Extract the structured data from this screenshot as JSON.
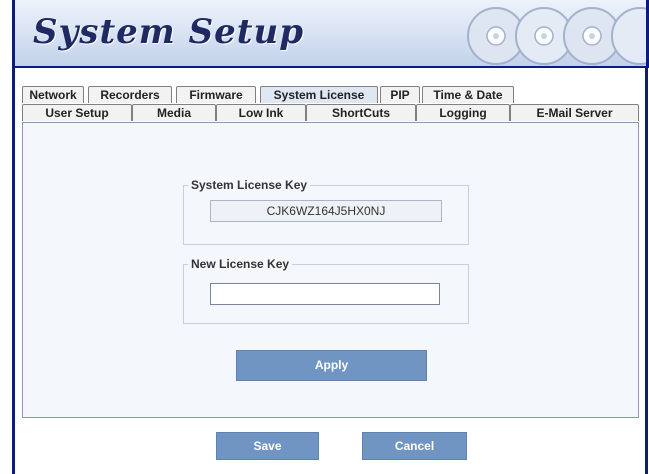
{
  "header": {
    "title": "System Setup"
  },
  "tabs_row1": [
    {
      "label": "Network",
      "selected": false
    },
    {
      "label": "Recorders",
      "selected": false
    },
    {
      "label": "Firmware",
      "selected": false
    },
    {
      "label": "System License",
      "selected": true
    },
    {
      "label": "PIP",
      "selected": false
    },
    {
      "label": "Time & Date",
      "selected": false
    }
  ],
  "tabs_row2": [
    {
      "label": "User Setup"
    },
    {
      "label": "Media"
    },
    {
      "label": "Low Ink"
    },
    {
      "label": "ShortCuts"
    },
    {
      "label": "Logging"
    },
    {
      "label": "E-Mail Server"
    }
  ],
  "license": {
    "current_legend": "System License Key",
    "current_value": "CJK6WZ164J5HX0NJ",
    "new_legend": "New License Key",
    "new_value": ""
  },
  "buttons": {
    "apply": "Apply",
    "save": "Save",
    "cancel": "Cancel"
  },
  "colors": {
    "frame": "#0b1e74",
    "button": "#7095c2",
    "panel": "#f4f7fc"
  },
  "icons": {
    "header_decoration": "cd-disc-icon"
  }
}
